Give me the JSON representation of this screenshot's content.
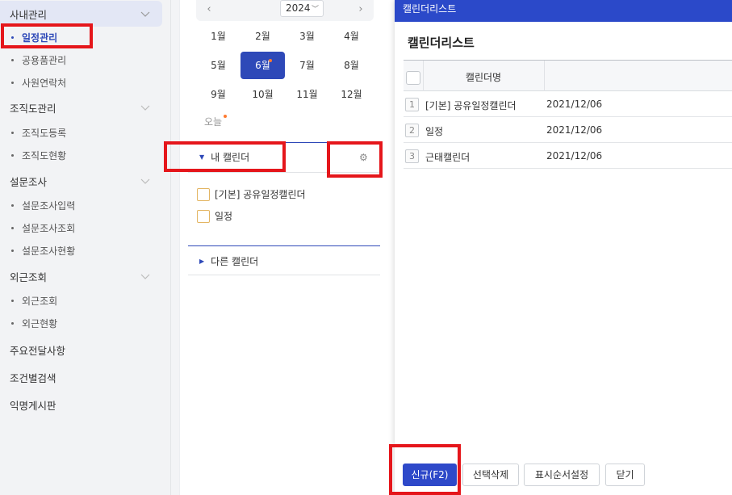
{
  "sidebar": {
    "groups": [
      {
        "label": "사내관리"
      },
      {
        "label": "조직도관리"
      },
      {
        "label": "설문조사"
      },
      {
        "label": "외근조회"
      }
    ],
    "sub": {
      "schedule": "일정관리",
      "equipment": "공용품관리",
      "contacts": "사원연락처",
      "org_register": "조직도등록",
      "org_status": "조직도현황",
      "survey_input": "설문조사입력",
      "survey_query": "설문조사조회",
      "survey_status": "설문조사현황",
      "outside_query": "외근조회",
      "outside_status": "외근현황"
    },
    "plain": {
      "notice": "주요전달사항",
      "search": "조건별검색",
      "anon_board": "익명게시판"
    }
  },
  "calendar": {
    "year": "2024",
    "months": [
      "1월",
      "2월",
      "3월",
      "4월",
      "5월",
      "6월",
      "7월",
      "8월",
      "9월",
      "10월",
      "11월",
      "12월"
    ],
    "selected_month": "6월",
    "today": "오늘",
    "my_calendars_title": "내 캘린더",
    "my_calendars": [
      "[기본] 공유일정캘린더",
      "일정"
    ],
    "other_calendars_title": "다른 캘린더"
  },
  "modal": {
    "bar_title": "캘린더리스트",
    "title": "캘린더리스트",
    "column_name": "캘린더명",
    "rows": [
      {
        "num": "1",
        "name": "[기본] 공유일정캘린더",
        "date": "2021/12/06"
      },
      {
        "num": "2",
        "name": "일정",
        "date": "2021/12/06"
      },
      {
        "num": "3",
        "name": "근태캘린더",
        "date": "2021/12/06"
      }
    ],
    "buttons": {
      "new": "신규(F2)",
      "delete": "선택삭제",
      "order": "표시순서설정",
      "close": "닫기"
    }
  },
  "colors": {
    "accent": "#2e49b8",
    "modal_bar": "#2b49c9",
    "highlight": "#e5161b",
    "dot": "#ff7a2f"
  }
}
